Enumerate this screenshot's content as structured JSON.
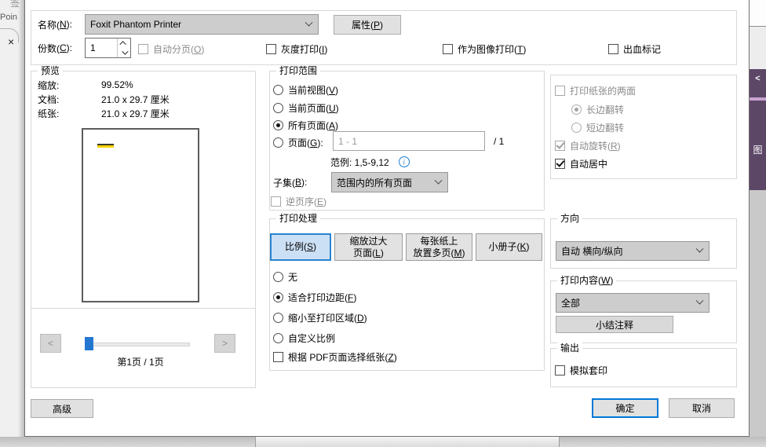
{
  "colors": {
    "accent": "#0078d7",
    "selected_tab_bg": "#cce0f5",
    "selected_tab_border": "#2a83d0",
    "panel_purple": "#5d4767",
    "panel_purple_divider": "#c9a2cf",
    "slider_handle": "#2477d1",
    "highlight_yellow": "#f5d400",
    "info_blue": "#1a7cd4"
  },
  "side_left": {
    "clipped_icon_text": "签",
    "point_text": "Poin",
    "close_label": "×"
  },
  "side_right": {
    "collapse_label": "<",
    "tab_label": "图"
  },
  "dialog": {
    "top": {
      "name_label": "名称(N):",
      "printer_name": "Foxit Phantom Printer",
      "properties_button": "属性(P)",
      "copies_label": "份数(C):",
      "copies_value": "1",
      "collate": "自动分页(O)",
      "grayscale": "灰度打印(I)",
      "as_image": "作为图像打印(T)",
      "bleed_marks": "出血标记"
    },
    "preview": {
      "title": "预览",
      "zoom_label": "缩放:",
      "zoom_value": "99.52%",
      "doc_label": "文档:",
      "doc_value": "21.0 x 29.7 厘米",
      "paper_label": "纸张:",
      "paper_value": "21.0 x 29.7 厘米",
      "prev_label": "<",
      "next_label": ">",
      "page_indicator": "第1页 / 1页"
    },
    "range": {
      "title": "打印范围",
      "current_view": "当前视图(V)",
      "current_page": "当前页面(U)",
      "all_pages": "所有页面(A)",
      "pages_label": "页面(G):",
      "pages_value": "1 - 1",
      "pages_total": "/ 1",
      "example": "范例: 1,5-9,12",
      "subset_label": "子集(B):",
      "subset_value": "范围内的所有页面",
      "reverse": "逆页序(E)"
    },
    "handling": {
      "title": "打印处理",
      "tab_scale": "比例(S)",
      "tab_oversize_line1": "缩放过大",
      "tab_oversize_line2": "页面(L)",
      "tab_multi_line1": "每张纸上",
      "tab_multi_line2": "放置多页(M)",
      "tab_booklet": "小册子(K)",
      "none": "无",
      "fit_margins": "适合打印边距(F)",
      "shrink_area": "缩小至打印区域(D)",
      "custom_scale": "自定义比例",
      "paper_by_pdf": "根据 PDF页面选择纸张(Z)"
    },
    "duplex": {
      "two_sided": "打印纸张的两面",
      "flip_long": "长边翻转",
      "flip_short": "短边翻转",
      "auto_rotate": "自动旋转(R)",
      "auto_center": "自动居中"
    },
    "orientation": {
      "title": "方向",
      "value": "自动 横向/纵向"
    },
    "content": {
      "title": "打印内容(W)",
      "value": "全部",
      "summarize_button": "小结注释"
    },
    "output": {
      "title": "输出",
      "simulate_overprint": "模拟套印"
    },
    "buttons": {
      "advanced": "高级",
      "ok": "确定",
      "cancel": "取消"
    }
  }
}
